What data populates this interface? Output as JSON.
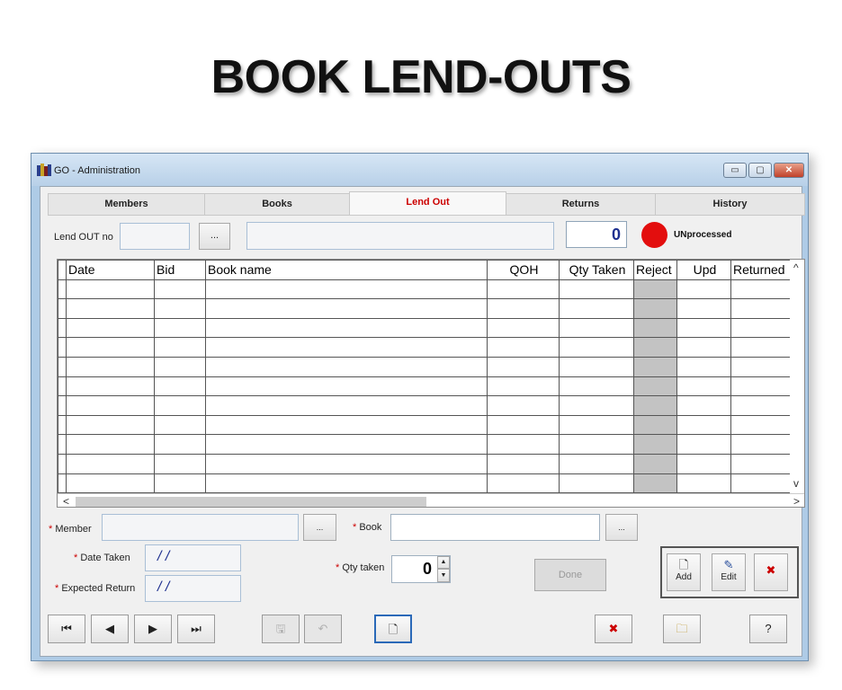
{
  "slide": {
    "title": "BOOK LEND-OUTS"
  },
  "window": {
    "title": "GO - Administration",
    "minimize": "▭",
    "maximize": "▢",
    "close": "✕"
  },
  "tabs": [
    {
      "label": "Members"
    },
    {
      "label": "Books"
    },
    {
      "label": "Lend Out"
    },
    {
      "label": "Returns"
    },
    {
      "label": "History"
    }
  ],
  "lendout": {
    "no_label": "Lend OUT no",
    "no_value": "",
    "browse_label": "...",
    "description": "",
    "count": "0",
    "status_text": "UNprocessed",
    "status_color": "#e30e0e"
  },
  "grid": {
    "columns": [
      "Date",
      "Bid",
      "Book name",
      "QOH",
      "Qty Taken",
      "Reject",
      "Upd",
      "Returned"
    ],
    "row_count": 11,
    "scroll_up": "^",
    "scroll_down": "v",
    "scroll_left": "<",
    "scroll_right": ">"
  },
  "form": {
    "required_mark": "*",
    "member_label": "Member",
    "member_value": "",
    "member_browse": "...",
    "book_label": "Book",
    "book_value": "",
    "book_browse": "...",
    "date_taken_label": "Date Taken",
    "date_taken_value": "/ /",
    "expected_return_label": "Expected Return",
    "expected_return_value": "/ /",
    "qty_label": "Qty taken",
    "qty_value": "0",
    "done_label": "Done"
  },
  "actions": {
    "add": "Add",
    "edit": "Edit"
  },
  "icons": {
    "first": "first-record-icon",
    "prev": "previous-record-icon",
    "next": "next-record-icon",
    "last": "last-record-icon",
    "save": "save-icon",
    "undo": "undo-icon",
    "new": "new-document-icon",
    "delete": "delete-icon",
    "folder": "open-folder-icon",
    "help": "help-icon"
  }
}
